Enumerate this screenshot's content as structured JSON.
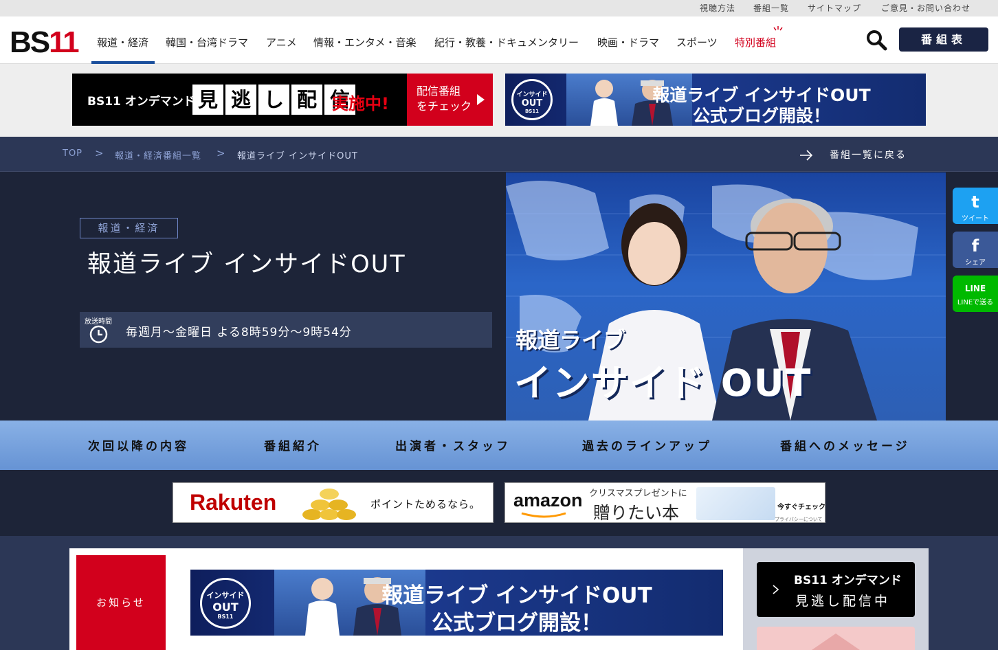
{
  "top_links": [
    "視聴方法",
    "番組一覧",
    "サイトマップ",
    "ご意見・お問い合わせ"
  ],
  "logo": {
    "bs": "BS",
    "num": "11"
  },
  "nav": [
    "報道・経済",
    "韓国・台湾ドラマ",
    "アニメ",
    "情報・エンタメ・音楽",
    "紀行・教養・ドキュメンタリー",
    "映画・ドラマ",
    "スポーツ",
    "特別番組"
  ],
  "schedule_label": "番組表",
  "promo_ondemand": {
    "logo": "BS11 オンデマンド",
    "words": [
      "見",
      "逃",
      "し",
      "配",
      "信"
    ],
    "status": "実施中!",
    "cta_line1": "配信番組",
    "cta_line2": "をチェック"
  },
  "promo_blog": {
    "badge_line1": "インサイド",
    "badge_line2": "OUT",
    "badge_bs": "BS11",
    "line1": "報道ライブ インサイドOUT",
    "line2": "公式ブログ開設！"
  },
  "breadcrumb": [
    "TOP",
    "報道・経済番組一覧",
    "報道ライブ インサイドOUT"
  ],
  "breadcrumb_sep": ">",
  "back_label": "番組一覧に戻る",
  "program": {
    "category": "報道・経済",
    "title": "報道ライブ インサイドOUT",
    "air_label": "放送時間",
    "air_time": "毎週月〜金曜日 よる8時59分〜9時54分"
  },
  "hero_logo": {
    "line1": "報道ライブ",
    "line2": "インサイド OUT"
  },
  "share": [
    {
      "glyph": "t",
      "label": "ツイート",
      "color": "#1da1f2"
    },
    {
      "glyph": "f",
      "label": "シェア",
      "color": "#3b5998"
    },
    {
      "glyph": "LINE",
      "label": "LINEで送る",
      "color": "#00b900"
    }
  ],
  "tabs": [
    "次回以降の内容",
    "番組紹介",
    "出演者・スタッフ",
    "過去のラインアップ",
    "番組へのメッセージ"
  ],
  "ads": {
    "rakuten_logo": "Rakuten",
    "rakuten_text": "ポイントためるなら。",
    "amazon_logo": "amazon",
    "amazon_sub": "クリスマスプレゼントに",
    "amazon_main": "贈りたい本",
    "amazon_cta": "今すぐチェック",
    "amazon_privacy": "プライバシーについて"
  },
  "news_label": "お知らせ",
  "side_ondemand": {
    "line1": "BS11 オンデマンド",
    "line2": "見逃し配信中"
  }
}
